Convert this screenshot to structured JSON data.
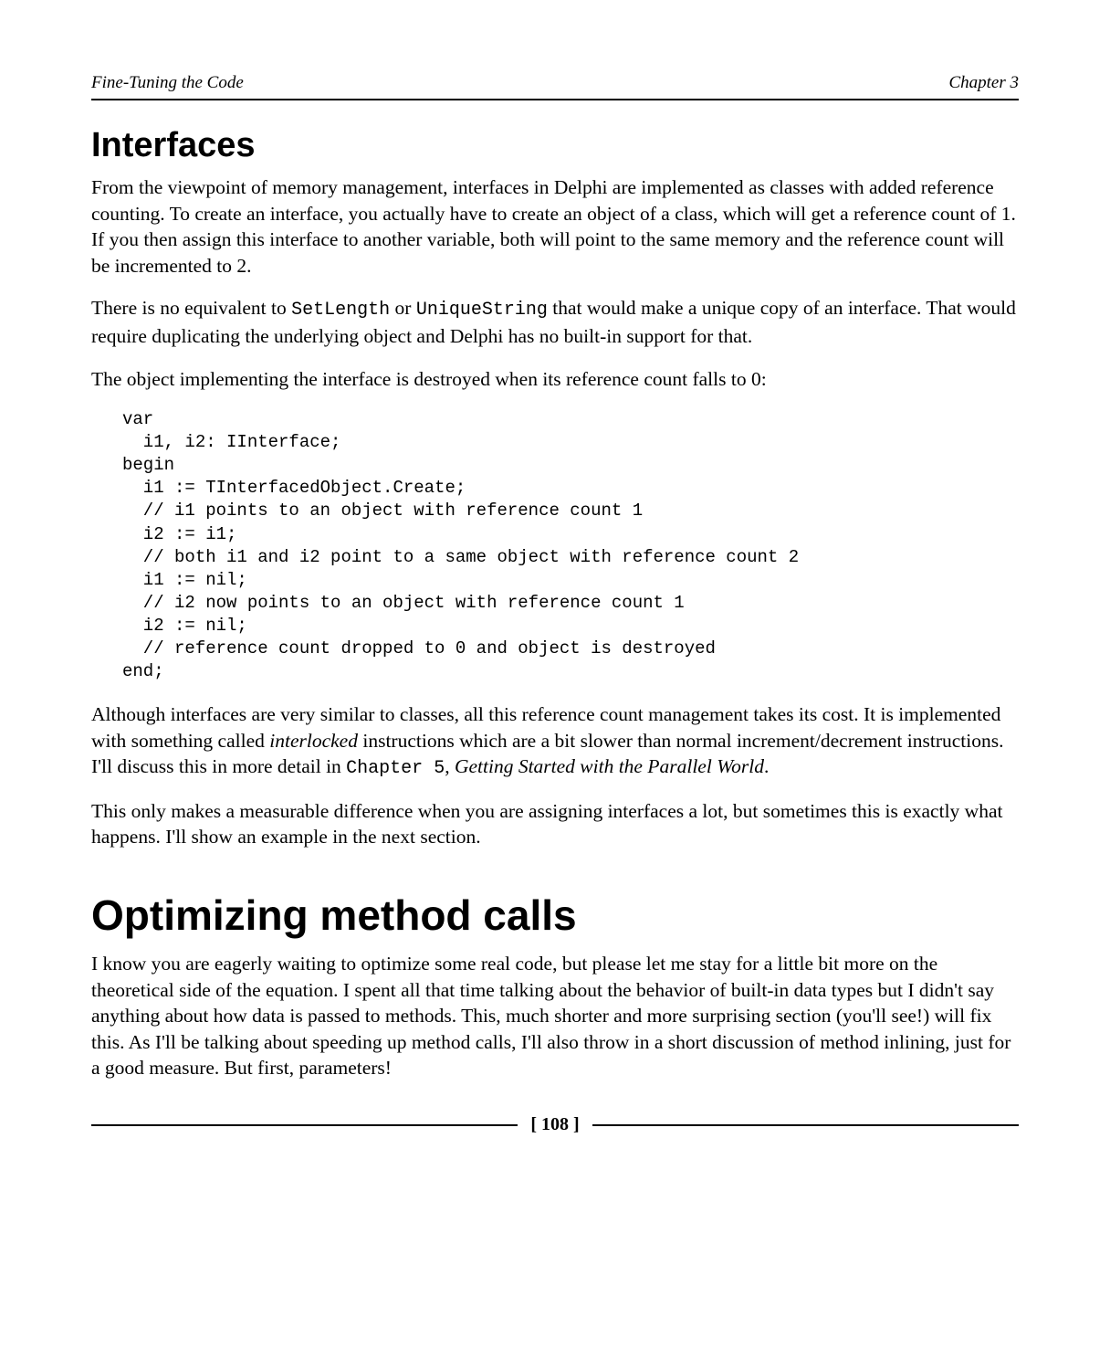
{
  "header": {
    "left": "Fine-Tuning the Code",
    "right": "Chapter 3"
  },
  "section1": {
    "heading": "Interfaces",
    "p1a": "From the viewpoint of memory management, interfaces in Delphi are implemented as classes with added reference counting. To create an interface, you actually have to create an object of a class, which will get a reference count of 1. If you then assign this interface to another variable, both will point to the same memory and the reference count will be incremented to 2.",
    "p2_pre": "There is no equivalent to ",
    "p2_code1": "SetLength",
    "p2_mid": " or ",
    "p2_code2": "UniqueString",
    "p2_post": " that would make a unique copy of an interface. That would require duplicating the underlying object and Delphi has no built-in support for that.",
    "p3": "The object implementing the interface is destroyed when its reference count falls to 0:",
    "code": "var\n  i1, i2: IInterface;\nbegin\n  i1 := TInterfacedObject.Create;\n  // i1 points to an object with reference count 1\n  i2 := i1;\n  // both i1 and i2 point to a same object with reference count 2\n  i1 := nil;\n  // i2 now points to an object with reference count 1\n  i2 := nil;\n  // reference count dropped to 0 and object is destroyed\nend;",
    "p4_pre": "Although interfaces are very similar to classes, all this reference count management takes its cost. It is implemented with something called ",
    "p4_em1": "interlocked",
    "p4_mid": " instructions which are a bit slower than normal increment/decrement instructions. I'll discuss this in more detail in ",
    "p4_code": "Chapter 5",
    "p4_sep": ", ",
    "p4_em2": "Getting Started with the Parallel World",
    "p4_post": ".",
    "p5": "This only makes a measurable difference when you are assigning interfaces a lot, but sometimes this is exactly what happens. I'll show an example in the next section."
  },
  "section2": {
    "heading": "Optimizing method calls",
    "p1": "I know you are eagerly waiting to optimize some real code, but please let me stay for a little bit more on the theoretical side of the equation. I spent all that time talking about the behavior of built-in data types but I didn't say anything about how data is passed to methods. This, much shorter and more surprising section (you'll see!) will fix this. As I'll be talking about speeding up method calls, I'll also throw in a short discussion of method inlining, just for a good measure. But first, parameters!"
  },
  "footer": {
    "page": "[ 108 ]"
  }
}
